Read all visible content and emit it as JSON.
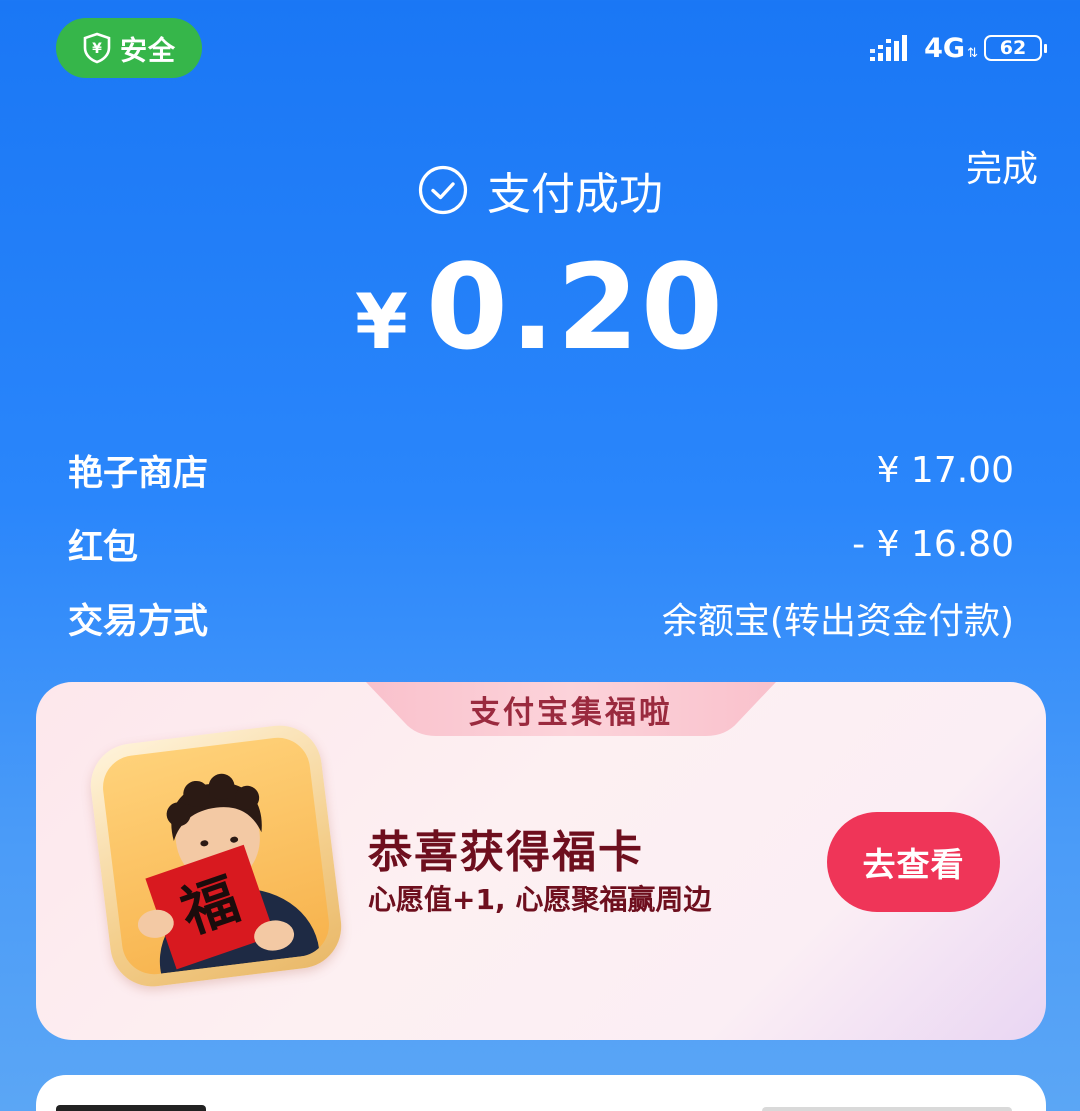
{
  "status_bar": {
    "safe_label": "安全",
    "network": "4G",
    "battery": "62",
    "icons": [
      "shield-yen-icon",
      "signal-icon",
      "battery-icon"
    ]
  },
  "header": {
    "done_label": "完成",
    "success_title": "支付成功",
    "currency": "¥",
    "amount": "0.20",
    "icons": [
      "check-circle-icon"
    ]
  },
  "details": [
    {
      "label": "艳子商店",
      "value": "¥ 17.00"
    },
    {
      "label": "红包",
      "value": "- ¥ 16.80"
    },
    {
      "label": "交易方式",
      "value": "余额宝(转出资金付款)"
    }
  ],
  "fu_card": {
    "tab_label": "支付宝集福啦",
    "title": "恭喜获得福卡",
    "subtitle": "心愿值+1, 心愿聚福赢周边",
    "button_label": "去查看",
    "photo_character": "福",
    "colors": {
      "button": "#ef3558",
      "title": "#6e0f1e"
    }
  },
  "colors": {
    "background": "#1a77f5",
    "safe_badge": "#36b64a"
  }
}
